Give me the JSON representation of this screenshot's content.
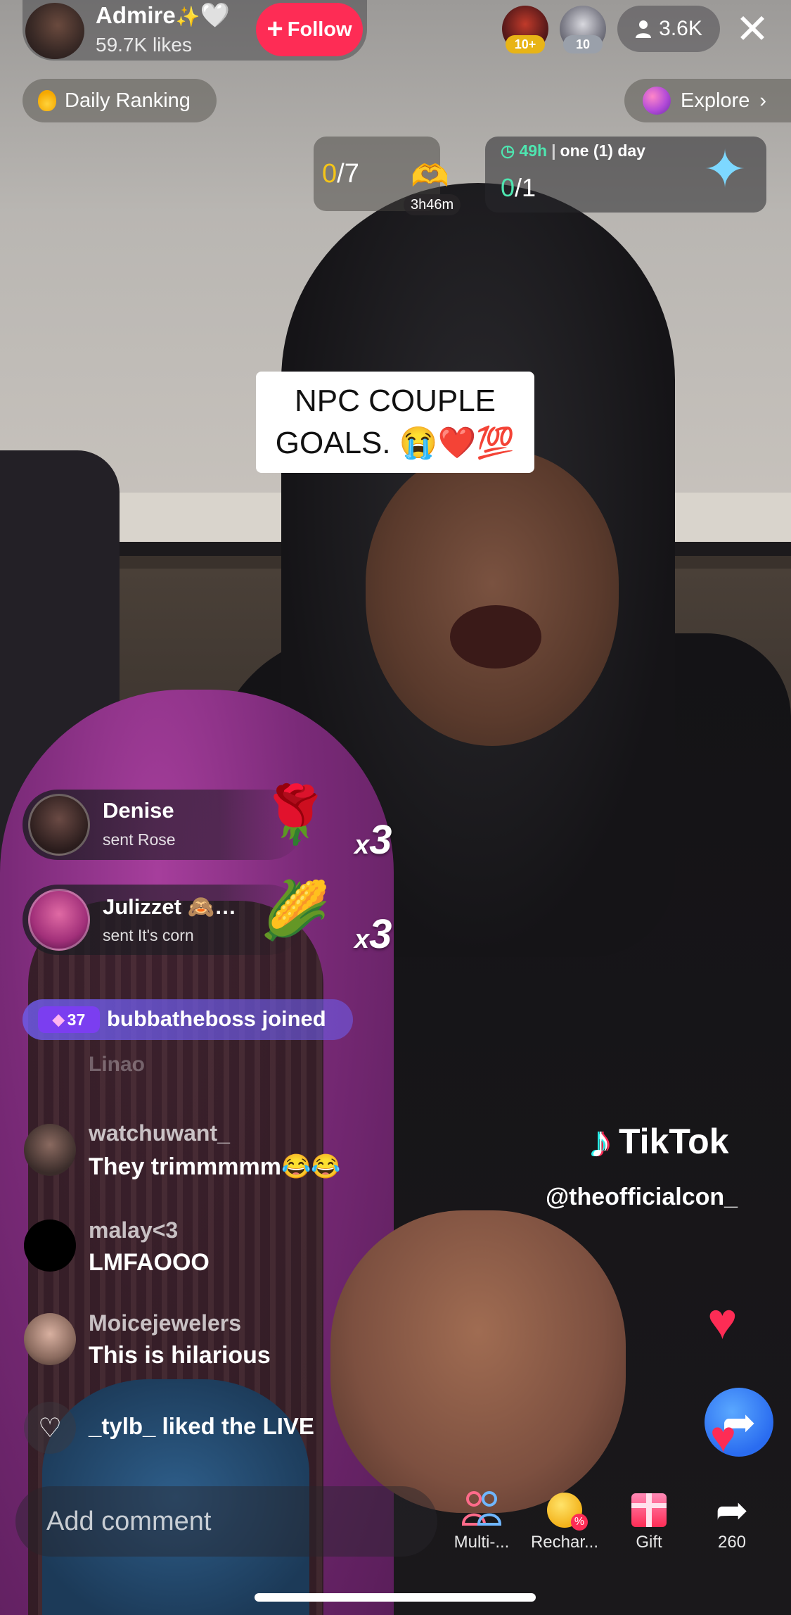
{
  "host": {
    "name": "Admire",
    "name_decoration": "✨",
    "heart": "🤍",
    "likes": "59.7K likes",
    "follow_label": "Follow",
    "follow_icon": "+"
  },
  "top_viewers": [
    {
      "badge": "10+"
    },
    {
      "badge": "10"
    }
  ],
  "viewer_count": "3.6K",
  "close_icon": "✕",
  "daily_ranking_label": "Daily Ranking",
  "explore_label": "Explore",
  "explore_chevron": "›",
  "goal": {
    "current": "0",
    "total": "/7",
    "timer": "3h46m",
    "icon": "🫶"
  },
  "quest": {
    "time": "49h",
    "separator": "|",
    "label": "one (1) day",
    "current": "0",
    "total": "/1"
  },
  "caption": {
    "line1": "NPC COUPLE",
    "line2": "GOALS. 😭❤️💯"
  },
  "gifts": [
    {
      "user": "Denise",
      "action": "sent Rose",
      "combo": "3",
      "icon": "🌹"
    },
    {
      "user": "Julizzet 🙈…",
      "action": "sent It's corn",
      "combo": "3",
      "icon": "🌽"
    }
  ],
  "combo_prefix": "x",
  "joined": {
    "level": "37",
    "text": "bubbatheboss joined"
  },
  "faded_comment_name": "Linao",
  "comments": [
    {
      "user": "watchuwant_",
      "text": "They trimmmmm😂😂"
    },
    {
      "user": "malay<3",
      "text": "LMFAOOO"
    },
    {
      "user": "Moicejewelers",
      "text": "This is hilarious"
    }
  ],
  "liked_text": "_tylb_ liked the LIVE",
  "watermark": {
    "brand": "TikTok",
    "handle": "@theofficialcon_"
  },
  "comment_placeholder": "Add comment",
  "toolbar": {
    "multi_label": "Multi-...",
    "recharge_label": "Rechar...",
    "gift_label": "Gift",
    "share_count": "260"
  },
  "colors": {
    "accent": "#fe2c55",
    "joined_banner": "#6e5ae6",
    "quest_green": "#4ee6b0",
    "goal_yellow": "#f5c518"
  }
}
